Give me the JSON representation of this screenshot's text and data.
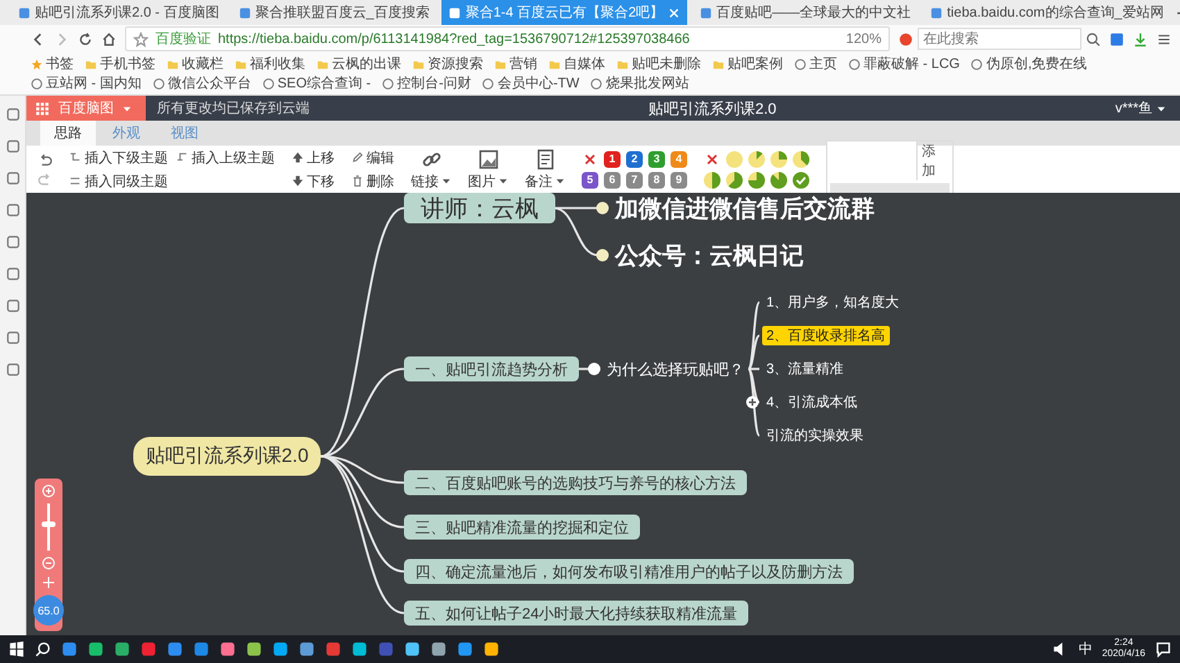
{
  "browser": {
    "tabs": [
      {
        "title": "贴吧引流系列课2.0 - 百度脑图",
        "selected": false
      },
      {
        "title": "聚合推联盟百度云_百度搜索",
        "selected": false
      },
      {
        "title": "聚合1-4 百度云已有【聚合2吧】",
        "selected": true
      },
      {
        "title": "百度贴吧——全球最大的中文社",
        "selected": false
      },
      {
        "title": "tieba.baidu.com的综合查询_爱站网",
        "selected": false
      }
    ],
    "site_badge": "百度验证",
    "url": "https://tieba.baidu.com/p/6113141984?red_tag=1536790712#125397038466",
    "zoom": "120%",
    "search_placeholder": "在此搜索",
    "bookmarks": [
      "书签",
      "手机书签",
      "收藏栏",
      "福利收集",
      "云枫的出课",
      "资源搜索",
      "营销",
      "自媒体",
      "贴吧未删除",
      "贴吧案例",
      "主页",
      "罪蔽破解 - LCG",
      "伪原创,免费在线",
      "豆站网 - 国内知",
      "微信公众平台",
      "SEO综合查询 - ",
      "控制台-问财",
      "会员中心-TW",
      "烧果批发网站"
    ]
  },
  "app": {
    "brand": "百度脑图",
    "save_status": "所有更改均已保存到云端",
    "doc_title": "贴吧引流系列课2.0",
    "user": "v***鱼",
    "tabs": [
      {
        "label": "思路",
        "selected": true
      },
      {
        "label": "外观",
        "selected": false
      },
      {
        "label": "视图",
        "selected": false
      }
    ],
    "toolbar": {
      "insert_child": "插入下级主题",
      "insert_parent": "插入上级主题",
      "insert_sibling": "插入同级主题",
      "move_up": "上移",
      "move_down": "下移",
      "edit": "编辑",
      "delete": "删除",
      "link": "链接",
      "image": "图片",
      "note": "备注",
      "priorities": [
        {
          "kind": "clear"
        },
        {
          "kind": "number",
          "label": "1",
          "color": "#e0221e"
        },
        {
          "kind": "number",
          "label": "2",
          "color": "#1f6fd1"
        },
        {
          "kind": "number",
          "label": "3",
          "color": "#2e9e2e"
        },
        {
          "kind": "number",
          "label": "4",
          "color": "#ef8a1a"
        },
        {
          "kind": "number",
          "label": "5",
          "color": "#7b55c9"
        },
        {
          "kind": "number",
          "label": "6",
          "color": "#8a8a8a"
        },
        {
          "kind": "number",
          "label": "7",
          "color": "#8a8a8a"
        },
        {
          "kind": "number",
          "label": "8",
          "color": "#8a8a8a"
        },
        {
          "kind": "number",
          "label": "9",
          "color": "#8a8a8a"
        }
      ],
      "progress": [
        {
          "kind": "clear"
        },
        {
          "kind": "zero"
        },
        {
          "kind": "one"
        },
        {
          "kind": "two"
        },
        {
          "kind": "three"
        },
        {
          "kind": "four"
        },
        {
          "kind": "five"
        },
        {
          "kind": "six"
        },
        {
          "kind": "seven"
        },
        {
          "kind": "done"
        }
      ],
      "tag_button": "添加"
    }
  },
  "mindmap": {
    "root": "贴吧引流系列课2.0",
    "topics": [
      {
        "text": "讲师：云枫",
        "children": [
          {
            "text": "加微信进微信售后交流群"
          },
          {
            "text": "公众号：云枫日记"
          }
        ]
      },
      {
        "text": "一、贴吧引流趋势分析",
        "children": [
          {
            "text": "为什么选择玩贴吧？",
            "children": [
              {
                "text": "1、用户多，知名度大",
                "selected": false,
                "collapsed": false
              },
              {
                "text": "2、百度收录排名高",
                "selected": true,
                "collapsed": false
              },
              {
                "text": "3、流量精准",
                "selected": false,
                "collapsed": false
              },
              {
                "text": "4、引流成本低",
                "selected": false,
                "collapsed": true
              },
              {
                "text": "引流的实操效果",
                "selected": false,
                "collapsed": false
              }
            ]
          }
        ]
      },
      {
        "text": "二、百度贴吧账号的选购技巧与养号的核心方法"
      },
      {
        "text": "三、贴吧精准流量的挖掘和定位"
      },
      {
        "text": "四、确定流量池后，如何发布吸引精准用户的帖子以及防删方法"
      },
      {
        "text": "五、如何让帖子24小时最大化持续获取精准流量"
      }
    ]
  },
  "zoom_control": {
    "level": 0.55,
    "reading": "65.0"
  },
  "taskbar": {
    "ime": "中",
    "time": "2:24",
    "date": "2020/4/16"
  }
}
